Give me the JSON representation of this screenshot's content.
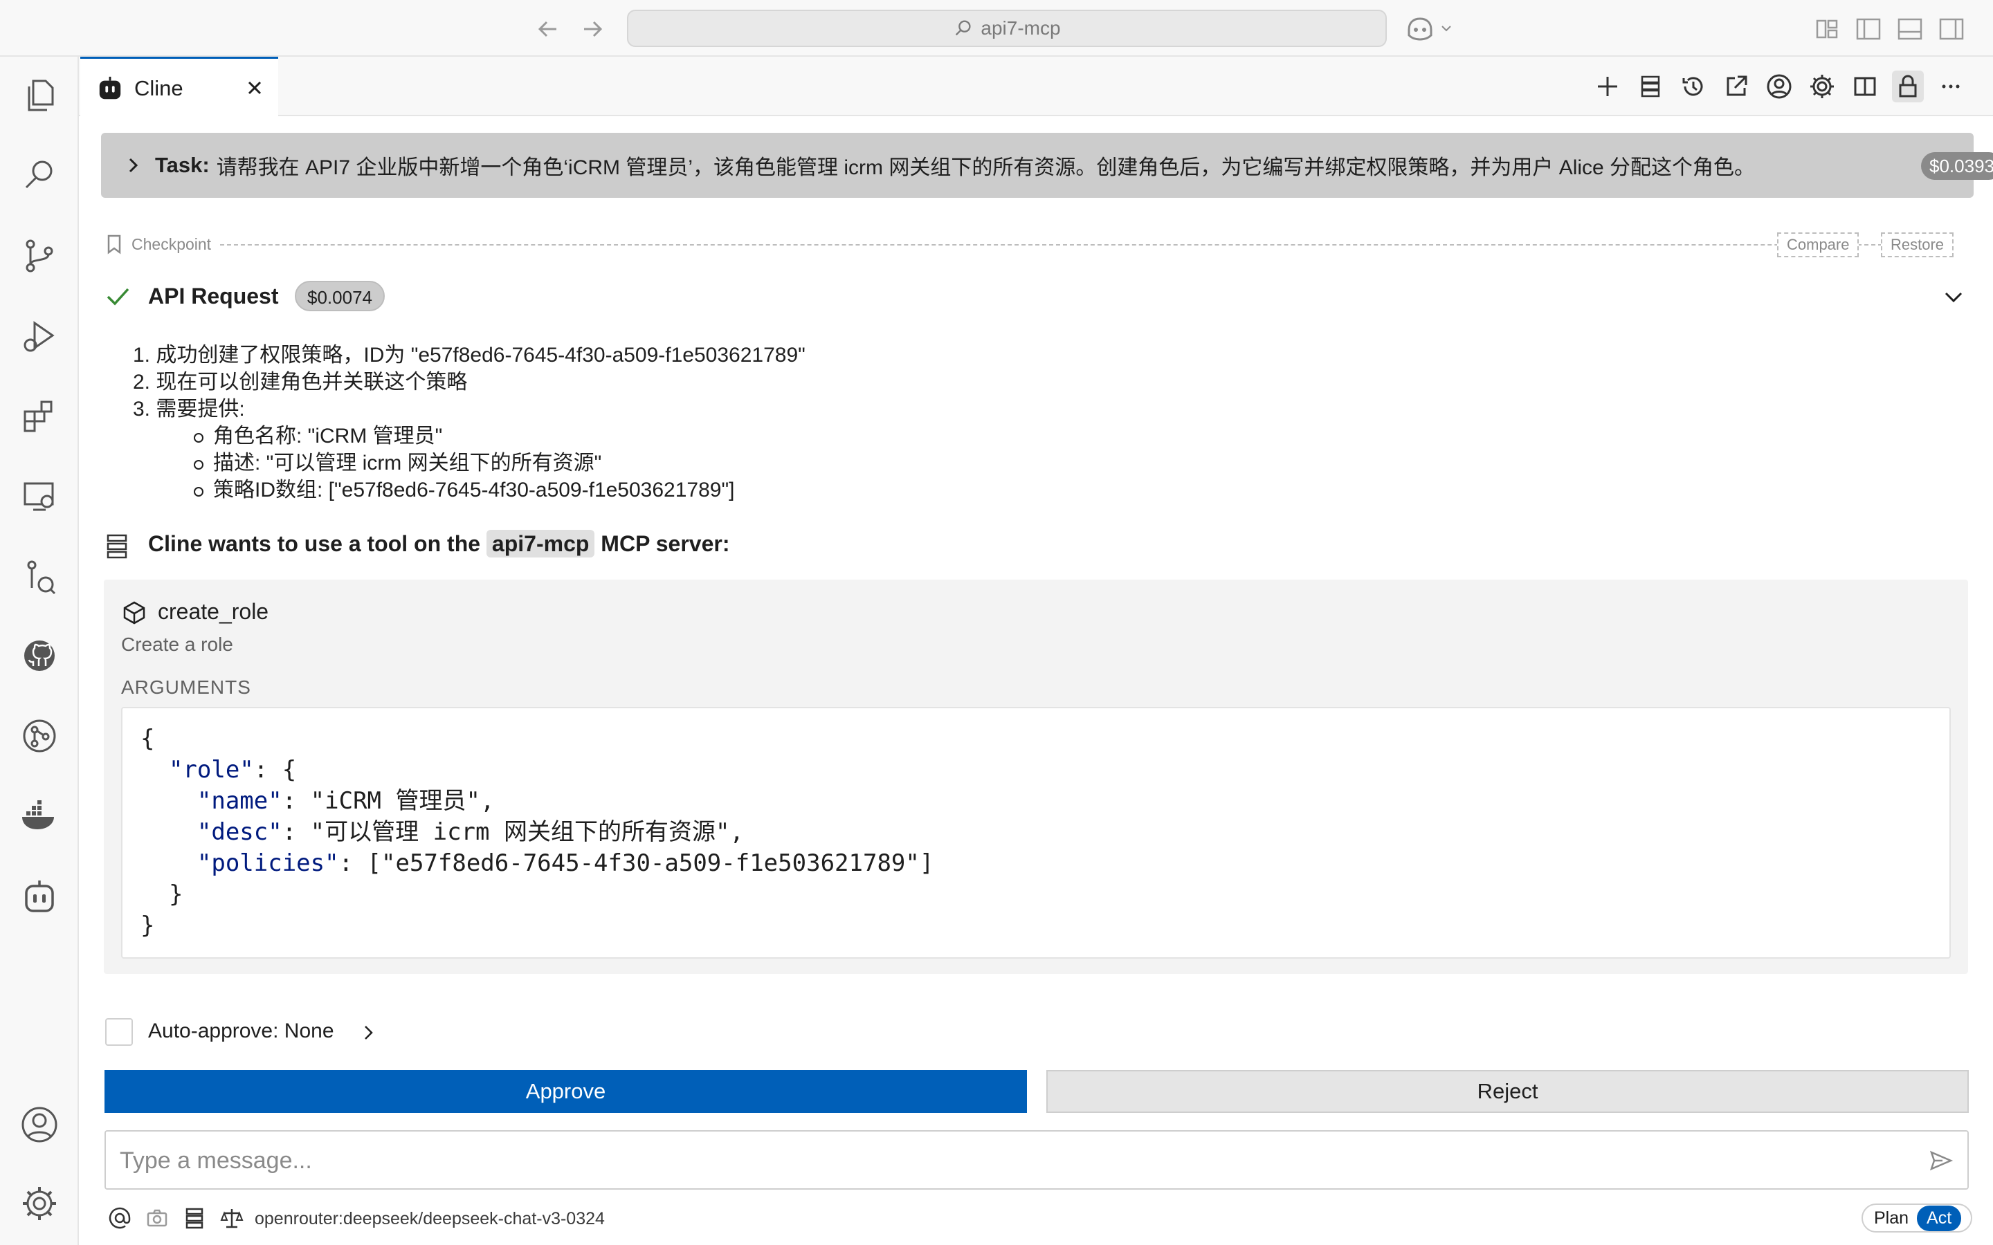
{
  "titlebar": {
    "search_text": "api7-mcp"
  },
  "tab": {
    "label": "Cline"
  },
  "task": {
    "label": "Task:",
    "text": "请帮我在 API7 企业版中新增一个角色‘iCRM 管理员’，该角色能管理 icrm 网关组下的所有资源。创建角色后，为它编写并绑定权限策略，并为用户 Alice 分配这个角色。",
    "cost": "$0.0393"
  },
  "checkpoint": {
    "label": "Checkpoint",
    "compare": "Compare",
    "restore": "Restore"
  },
  "api_request": {
    "title": "API Request",
    "cost": "$0.0074",
    "steps": [
      "1. 成功创建了权限策略，ID为 \"e57f8ed6-7645-4f30-a509-f1e503621789\"",
      "2. 现在可以创建角色并关联这个策略",
      "3. 需要提供:"
    ],
    "substeps": [
      "角色名称: \"iCRM 管理员\"",
      "描述: \"可以管理 icrm 网关组下的所有资源\"",
      "策略ID数组: [\"e57f8ed6-7645-4f30-a509-f1e503621789\"]"
    ]
  },
  "mcp": {
    "prefix": "Cline wants to use a tool on the",
    "server": "api7-mcp",
    "suffix": "MCP server:"
  },
  "tool": {
    "name": "create_role",
    "description": "Create a role",
    "args_label": "ARGUMENTS",
    "json": {
      "open": "{",
      "role_key": "\"role\"",
      "role_open": ": {",
      "name_key": "\"name\"",
      "name_val": ": \"iCRM 管理员\",",
      "desc_key": "\"desc\"",
      "desc_val": ": \"可以管理 icrm 网关组下的所有资源\",",
      "policies_key": "\"policies\"",
      "policies_val": ": [\"e57f8ed6-7645-4f30-a509-f1e503621789\"]",
      "inner_close": "}",
      "close": "}"
    }
  },
  "auto_approve": {
    "label": "Auto-approve: None"
  },
  "buttons": {
    "approve": "Approve",
    "reject": "Reject"
  },
  "message": {
    "placeholder": "Type a message..."
  },
  "footer": {
    "model": "openrouter:deepseek/deepseek-chat-v3-0324",
    "plan": "Plan",
    "act": "Act",
    "mode": "Act"
  },
  "colors": {
    "accent": "#005fb8",
    "task_bg": "#cccccc",
    "success": "#388a34"
  }
}
